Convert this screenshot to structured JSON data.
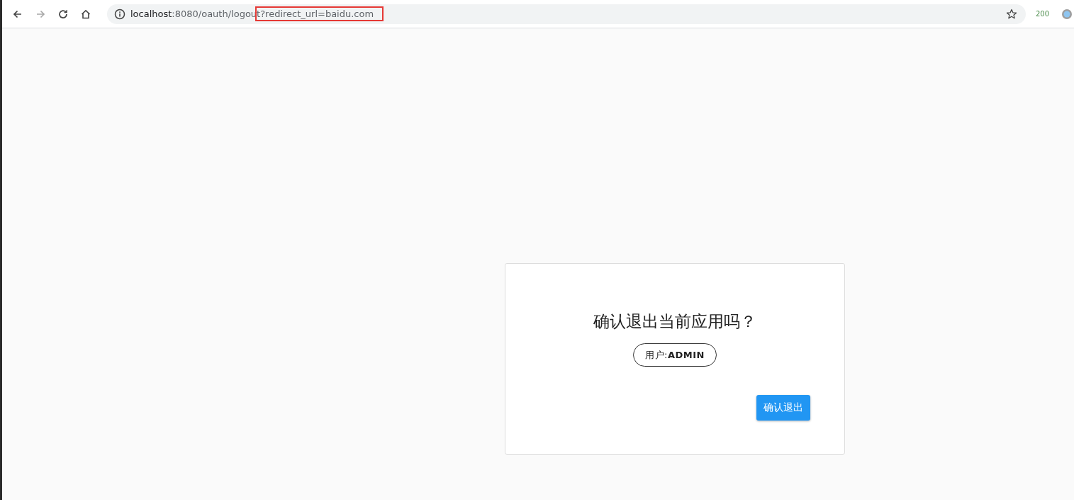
{
  "browser": {
    "nav": [
      {
        "kind": "back",
        "disabled": false
      },
      {
        "kind": "forward",
        "disabled": true
      },
      {
        "kind": "reload",
        "disabled": false
      },
      {
        "kind": "home",
        "disabled": false
      }
    ],
    "address": {
      "host": "localhost",
      "path": ":8080/oauth/logou",
      "highlighted": "t?redirect_url=baidu.com"
    },
    "status_code": "200"
  },
  "dialog": {
    "title": "确认退出当前应用吗？",
    "user_chip": "用户:**ADMIN**",
    "confirm_button": "确认退出"
  }
}
